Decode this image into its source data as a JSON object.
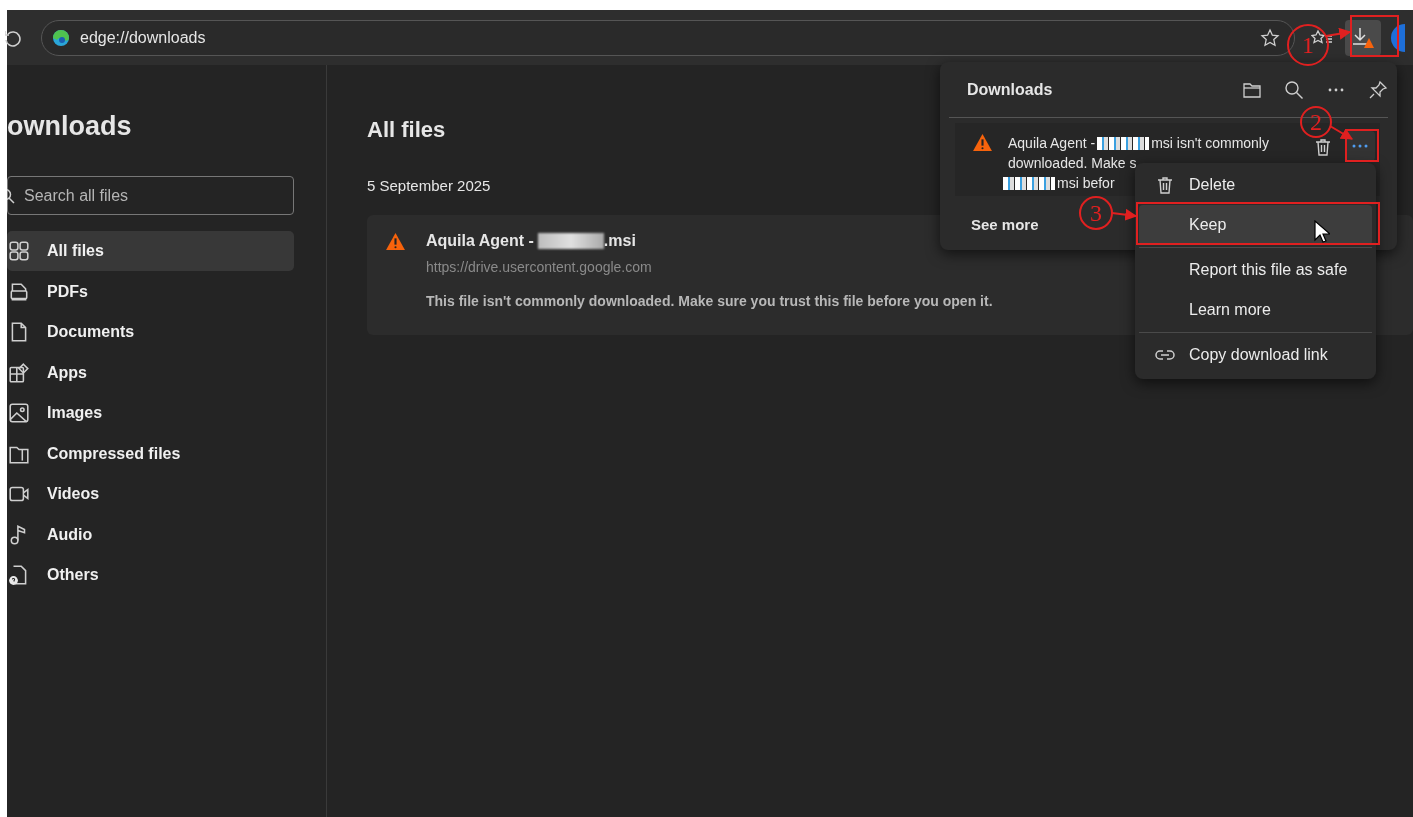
{
  "toolbar": {
    "address": "edge://downloads"
  },
  "sidebar": {
    "title": "ownloads",
    "search": {
      "placeholder": "Search all files"
    },
    "items": [
      {
        "label": "All files",
        "kind": "grid",
        "selected": true
      },
      {
        "label": "PDFs",
        "kind": "pdf",
        "selected": false
      },
      {
        "label": "Documents",
        "kind": "doc",
        "selected": false
      },
      {
        "label": "Apps",
        "kind": "apps",
        "selected": false
      },
      {
        "label": "Images",
        "kind": "image",
        "selected": false
      },
      {
        "label": "Compressed files",
        "kind": "zip",
        "selected": false
      },
      {
        "label": "Videos",
        "kind": "video",
        "selected": false
      },
      {
        "label": "Audio",
        "kind": "audio",
        "selected": false
      },
      {
        "label": "Others",
        "kind": "other",
        "selected": false
      }
    ]
  },
  "main": {
    "title": "All files",
    "groups": [
      {
        "date": "5 September 2025",
        "files": [
          {
            "name_start": "Aquila Agent -",
            "name_end": ".msi",
            "url": "https://drive.usercontent.google.com",
            "warning": "This file isn't commonly downloaded. Make sure you trust this file before you open it."
          }
        ]
      }
    ]
  },
  "downloads_panel": {
    "title": "Downloads",
    "item": {
      "line1_start": "Aquila Agent -",
      "line1_end": "msi isn't commonly",
      "line2": "downloaded. Make s",
      "line3_end": "msi befor"
    },
    "see_more": "See more"
  },
  "context_menu": {
    "groups": [
      {
        "items": [
          {
            "label": "Delete",
            "kind": "delete",
            "selected": false
          },
          {
            "label": "Keep",
            "kind": "plain",
            "selected": true
          }
        ]
      },
      {
        "items": [
          {
            "label": "Report this file as safe",
            "kind": "plain",
            "selected": false
          },
          {
            "label": "Learn more",
            "kind": "plain",
            "selected": false
          }
        ]
      },
      {
        "items": [
          {
            "label": "Copy download link",
            "kind": "link",
            "selected": false
          }
        ]
      }
    ]
  },
  "annotations": [
    {
      "label": "1"
    },
    {
      "label": "2"
    },
    {
      "label": "3"
    }
  ]
}
